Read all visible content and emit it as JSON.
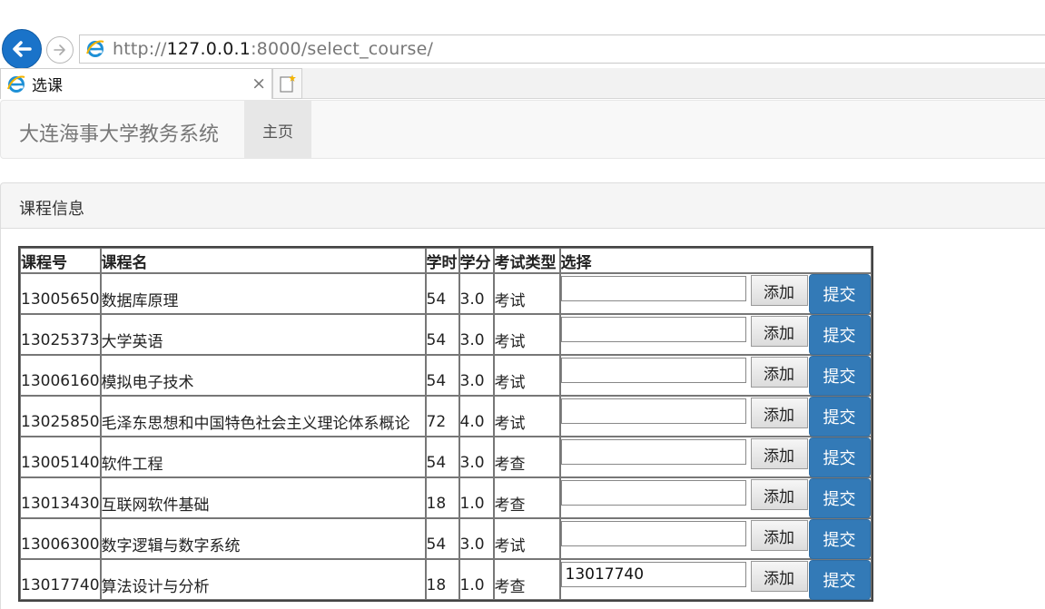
{
  "browser": {
    "url_prefix": "http://",
    "url_host": "127.0.0.1",
    "url_rest": ":8000/select_course/",
    "tab_title": "选课",
    "tab_close": "×"
  },
  "navbar": {
    "brand": "大连海事大学教务系统",
    "home": "主页"
  },
  "panel": {
    "title": "课程信息"
  },
  "table": {
    "headers": [
      "课程号",
      "课程名",
      "学时",
      "学分",
      "考试类型",
      "选择"
    ],
    "add_label": "添加",
    "submit_label": "提交",
    "rows": [
      {
        "id": "13005650",
        "name": "数据库原理",
        "hours": "54",
        "credit": "3.0",
        "exam": "考试",
        "input": ""
      },
      {
        "id": "13025373",
        "name": "大学英语",
        "hours": "54",
        "credit": "3.0",
        "exam": "考试",
        "input": ""
      },
      {
        "id": "13006160",
        "name": "模拟电子技术",
        "hours": "54",
        "credit": "3.0",
        "exam": "考试",
        "input": ""
      },
      {
        "id": "13025850",
        "name": "毛泽东思想和中国特色社会主义理论体系概论",
        "hours": "72",
        "credit": "4.0",
        "exam": "考试",
        "input": ""
      },
      {
        "id": "13005140",
        "name": "软件工程",
        "hours": "54",
        "credit": "3.0",
        "exam": "考查",
        "input": ""
      },
      {
        "id": "13013430",
        "name": "互联网软件基础",
        "hours": "18",
        "credit": "1.0",
        "exam": "考查",
        "input": ""
      },
      {
        "id": "13006300",
        "name": "数字逻辑与数字系统",
        "hours": "54",
        "credit": "3.0",
        "exam": "考试",
        "input": ""
      },
      {
        "id": "13017740",
        "name": "算法设计与分析",
        "hours": "18",
        "credit": "1.0",
        "exam": "考查",
        "input": "13017740"
      }
    ]
  }
}
